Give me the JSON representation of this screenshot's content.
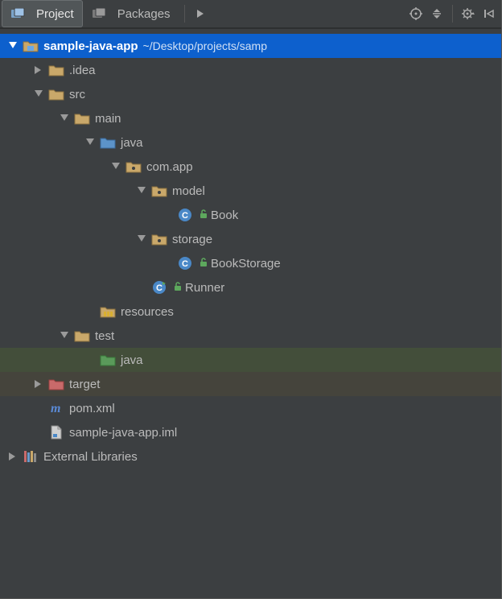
{
  "toolbar": {
    "tabs": [
      {
        "label": "Project",
        "active": true
      },
      {
        "label": "Packages",
        "active": false
      }
    ]
  },
  "tree": {
    "root": {
      "name": "sample-java-app",
      "path": "~/Desktop/projects/samp"
    },
    "idea": ".idea",
    "src": "src",
    "main": "main",
    "java": "java",
    "pkg": "com.app",
    "model": "model",
    "book": "Book",
    "storage": "storage",
    "bookstorage": "BookStorage",
    "runner": "Runner",
    "resources": "resources",
    "test": "test",
    "testjava": "java",
    "target": "target",
    "pom": "pom.xml",
    "iml": "sample-java-app.iml",
    "extlib": "External Libraries"
  }
}
